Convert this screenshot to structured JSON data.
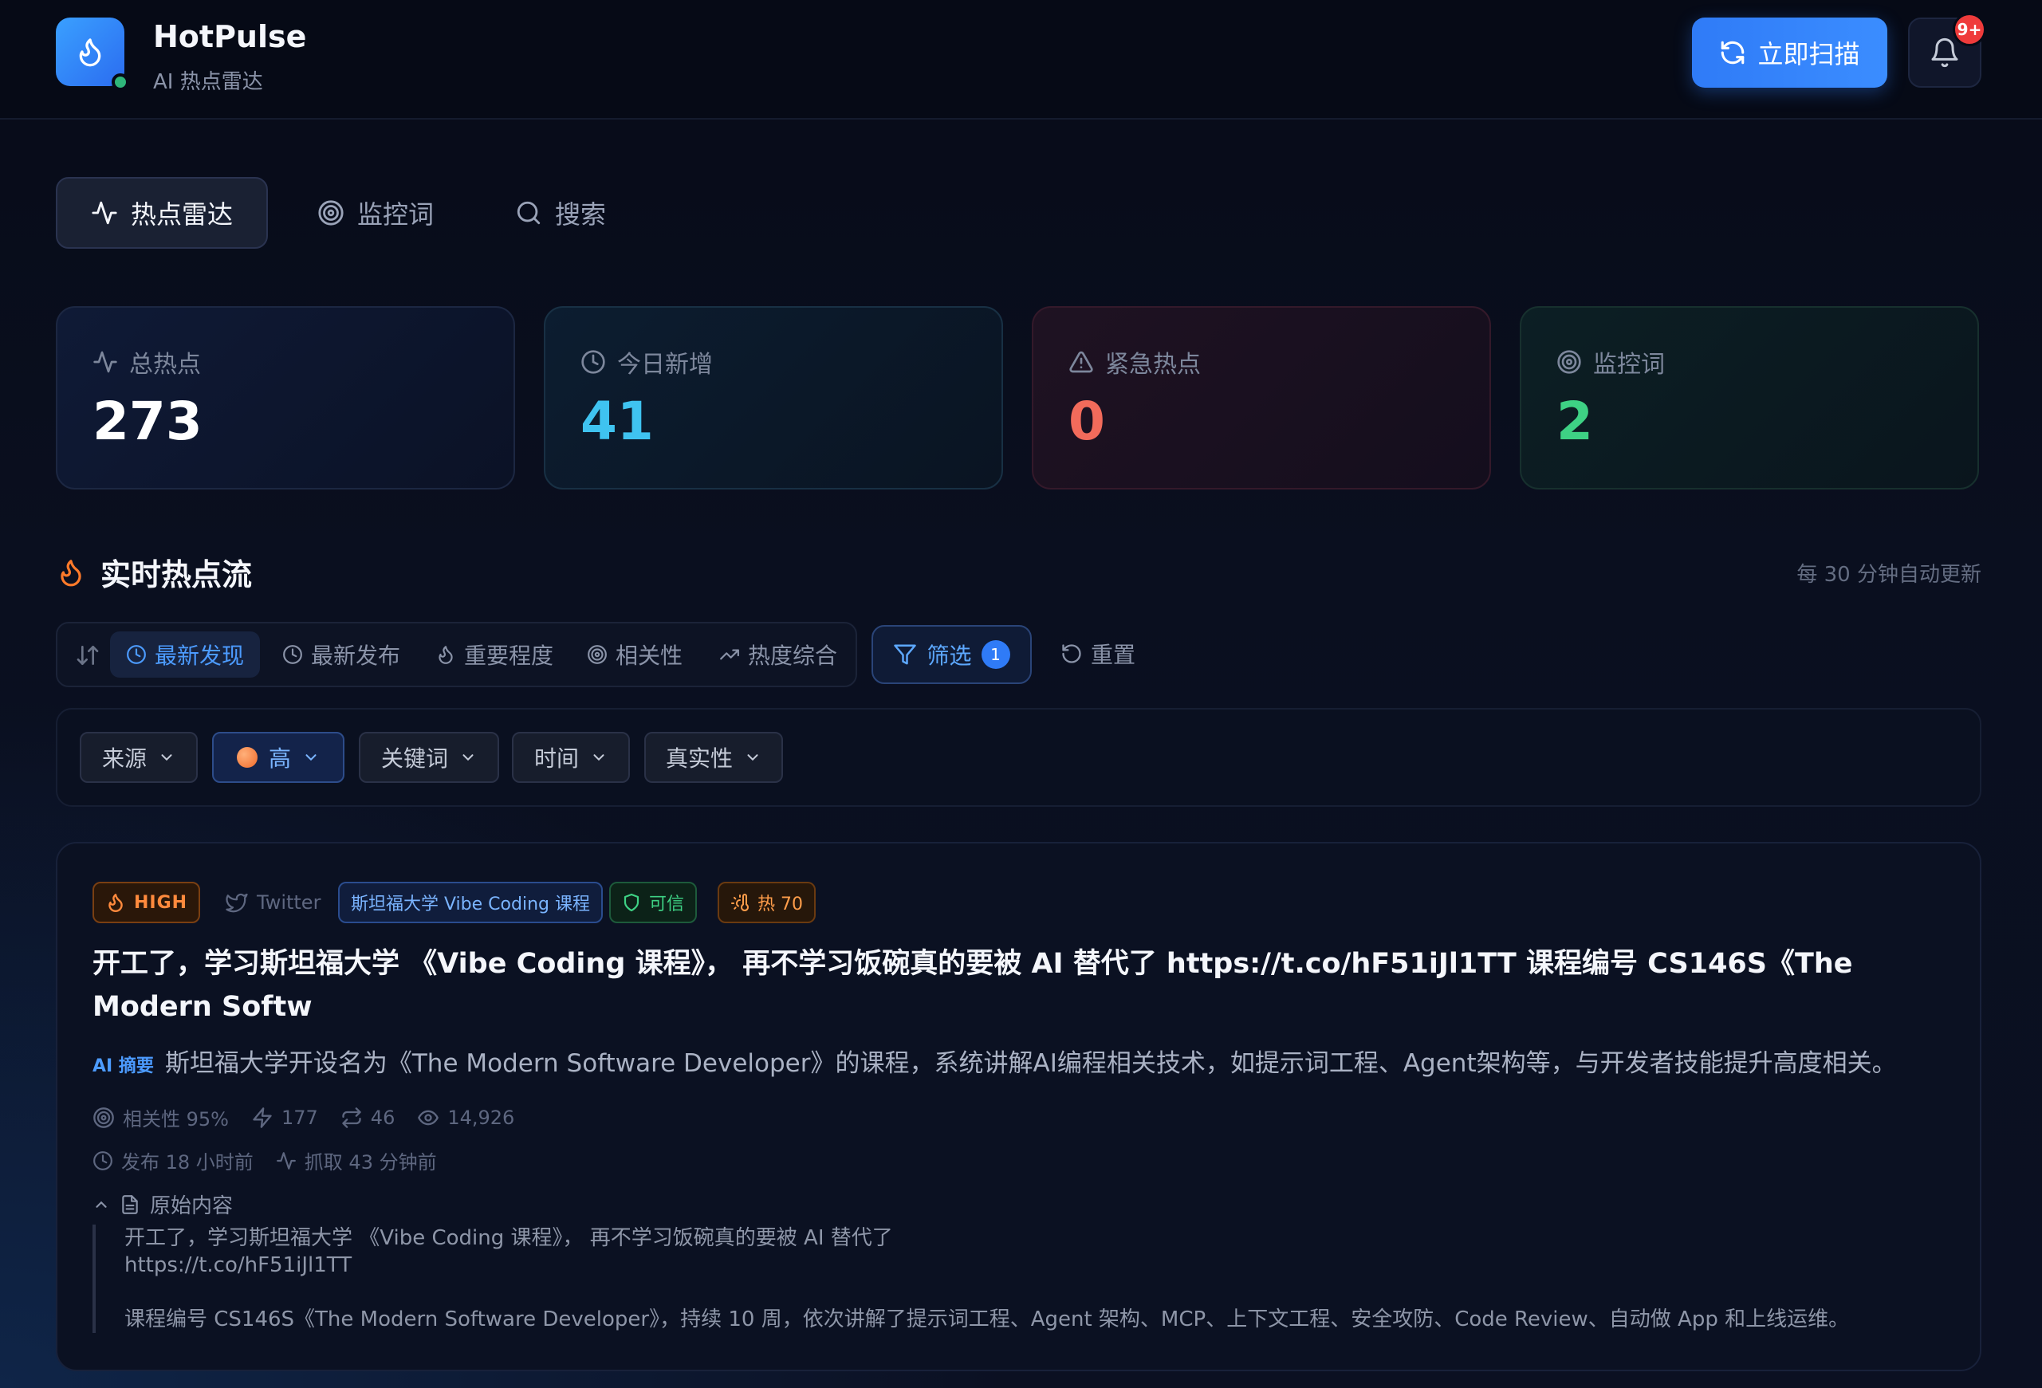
{
  "app": {
    "title": "HotPulse",
    "subtitle": "AI 热点雷达"
  },
  "header": {
    "scan_label": "立即扫描",
    "notification_badge": "9+"
  },
  "tabs": [
    {
      "label": "热点雷达",
      "icon": "activity-icon",
      "active": true
    },
    {
      "label": "监控词",
      "icon": "target-icon",
      "active": false
    },
    {
      "label": "搜索",
      "icon": "search-icon",
      "active": false
    }
  ],
  "stats": [
    {
      "label": "总热点",
      "value": "273",
      "icon": "activity-icon",
      "color": "#ffffff"
    },
    {
      "label": "今日新增",
      "value": "41",
      "icon": "clock-icon",
      "color": "#3fc3f0"
    },
    {
      "label": "紧急热点",
      "value": "0",
      "icon": "alert-icon",
      "color": "#f26b5b"
    },
    {
      "label": "监控词",
      "value": "2",
      "icon": "target-icon",
      "color": "#3ed184"
    }
  ],
  "stream": {
    "title": "实时热点流",
    "auto_update": "每 30 分钟自动更新"
  },
  "sort": {
    "options": [
      "最新发现",
      "最新发布",
      "重要程度",
      "相关性",
      "热度综合"
    ],
    "active_index": 0
  },
  "filter": {
    "label": "筛选",
    "count": "1",
    "reset_label": "重置",
    "chips": [
      {
        "label": "来源",
        "selected": false
      },
      {
        "label": "高",
        "selected": true
      },
      {
        "label": "关键词",
        "selected": false
      },
      {
        "label": "时间",
        "selected": false
      },
      {
        "label": "真实性",
        "selected": false
      }
    ]
  },
  "hot_item": {
    "level": "HIGH",
    "source": "Twitter",
    "topic_tag": "斯坦福大学 Vibe Coding 课程",
    "credibility": "可信",
    "heat": "热 70",
    "title": "开工了，学习斯坦福大学 《Vibe Coding 课程》， 再不学习饭碗真的要被 AI 替代了 https://t.co/hF51iJl1TT 课程编号 CS146S《The Modern Softw",
    "ai_label": "AI 摘要",
    "ai_summary": "斯坦福大学开设名为《The Modern Software Developer》的课程，系统讲解AI编程相关技术，如提示词工程、Agent架构等，与开发者技能提升高度相关。",
    "relevance": "相关性 95%",
    "likes": "177",
    "retweets": "46",
    "views": "14,926",
    "published": "发布 18 小时前",
    "fetched": "抓取 43 分钟前",
    "raw_label": "原始内容",
    "raw_line1": "开工了，学习斯坦福大学 《Vibe Coding 课程》， 再不学习饭碗真的要被 AI 替代了",
    "raw_line2": "https://t.co/hF51iJl1TT",
    "raw_line3": "课程编号 CS146S《The Modern Software Developer》，持续 10 周，依次讲解了提示词工程、Agent 架构、MCP、上下文工程、安全攻防、Code Review、自动做 App 和上线运维。"
  }
}
